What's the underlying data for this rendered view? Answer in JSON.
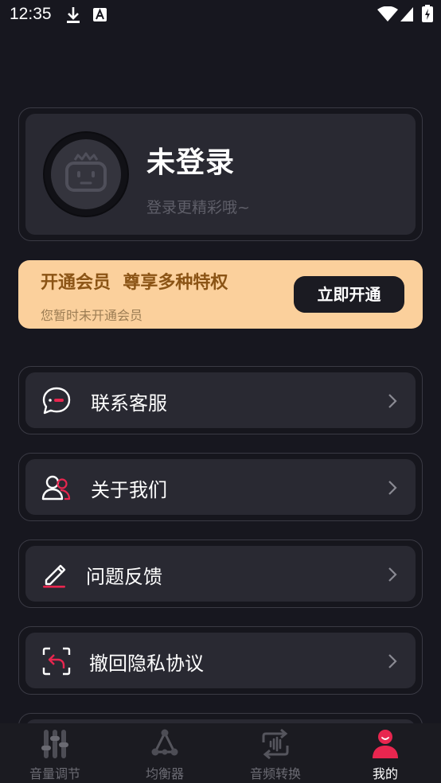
{
  "status_bar": {
    "time": "12:35"
  },
  "profile": {
    "name": "未登录",
    "subtitle": "登录更精彩哦~"
  },
  "vip": {
    "title": "开通会员  尊享多种特权",
    "subtitle": "您暂时未开通会员",
    "button": "立即开通"
  },
  "menu": [
    {
      "label": "联系客服",
      "icon": "chat-bubble-icon"
    },
    {
      "label": "关于我们",
      "icon": "users-icon"
    },
    {
      "label": "问题反馈",
      "icon": "edit-icon"
    },
    {
      "label": "撤回隐私协议",
      "icon": "revoke-icon"
    }
  ],
  "tabs": [
    {
      "label": "音量调节",
      "icon": "sliders-icon",
      "active": false
    },
    {
      "label": "均衡器",
      "icon": "equalizer-icon",
      "active": false
    },
    {
      "label": "音频转换",
      "icon": "audio-convert-icon",
      "active": false
    },
    {
      "label": "我的",
      "icon": "profile-icon",
      "active": true
    }
  ],
  "colors": {
    "accent": "#e8264f",
    "vip_bg": "#fbd09c",
    "background": "#17171f"
  }
}
